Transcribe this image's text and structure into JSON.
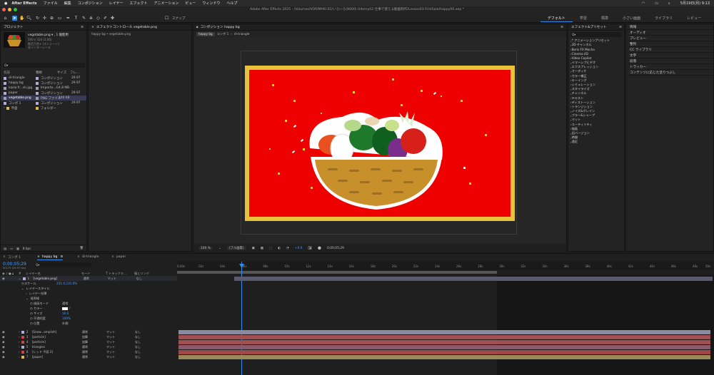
{
  "menubar": {
    "app": "After Effects",
    "items": [
      "ファイル",
      "編集",
      "コンポジション",
      "レイヤー",
      "エフェクト",
      "アニメーション",
      "ビュー",
      "ウィンドウ",
      "ヘルプ"
    ],
    "clock": "5月19日(月) 9:13"
  },
  "toolbar": {
    "window_title": "Adobe After Effects 2025 - /Volumes/VORIMAKI 02/いろいろ(8000) Udemy02 仕事で使える動画制作/Lesson03 FirstSale/happy00.aep *",
    "snap_label": "スナップ",
    "workspaces": [
      "デフォルト",
      "学習",
      "標準",
      "小さい画面",
      "ライブラリ",
      "レビュー"
    ],
    "active_workspace": "デフォルト"
  },
  "project": {
    "tab": "プロジェクト",
    "item_name": "vegetable.png ▾ , 1 個使用",
    "item_info1": "500 x 324 (1.00)",
    "item_info2": "数百万色+ (ストレート)",
    "item_info3": "非インターレース",
    "search_placeholder": "Q▾",
    "headers": [
      "名前",
      "種類",
      "サイズ",
      "フレ..."
    ],
    "rows": [
      {
        "name": "di-triangle",
        "type": "コンポジション",
        "size": "",
        "fr": "29.97",
        "color": "#b8a9d9"
      },
      {
        "name": "happy bg",
        "type": "コンポジション",
        "size": "",
        "fr": "29.97",
        "color": "#b8a9d9"
      },
      {
        "name": "kazia fr...sh.jpg",
        "type": "Importe...G",
        "size": "4.8 MB",
        "fr": "",
        "color": "#9aa2b0"
      },
      {
        "name": "paper",
        "type": "コンポジション",
        "size": "",
        "fr": "29.97",
        "color": "#b8a9d9"
      },
      {
        "name": "vegetable.png",
        "type": "PNG ファイル",
        "size": "140 KB",
        "fr": "",
        "color": "#9aa2b0"
      },
      {
        "name": "コンポ 1",
        "type": "コンポジション",
        "size": "",
        "fr": "29.97",
        "color": "#b8a9d9"
      },
      {
        "name": "平面",
        "type": "フォルダー",
        "size": "",
        "fr": "",
        "color": "#e0b94a"
      }
    ],
    "bpc": "8 bpc"
  },
  "effect_controls": {
    "tab": "エフェクトコントロール vegetable.png",
    "subtitle": "happy bg • vegetable.png"
  },
  "composition": {
    "tab": "コンポジション happy bg",
    "breadcrumbs": [
      "happy bg",
      "コンポ 1",
      "di-triangle"
    ],
    "zoom": "100 %",
    "quality": "(フル画質)",
    "exposure": "+0.0",
    "timecode": "0;00;05;29"
  },
  "effects_presets": {
    "tab": "エフェクト&プリセット",
    "search_placeholder": "Q▾",
    "items": [
      "* アニメーションプリセット",
      "3D チャンネル",
      "Boris FX Mocha",
      "Cinema 4D",
      "Video Copilot",
      "イマーシブビデオ",
      "エクスプレッション",
      "オーディオ",
      "カラー補正",
      "キーイング",
      "シミュレーション",
      "スタイライズ",
      "チャンネル",
      "テキスト",
      "ディストーション",
      "トランジション",
      "ノイズ&グレイン",
      "ブラー&シャープ",
      "マット",
      "ユーティリティ",
      "描画",
      "旧バージョン",
      "時間",
      "遠近"
    ]
  },
  "right_panel": {
    "items": [
      "情報",
      "オーディオ",
      "プレビュー",
      "整列",
      "CC ライブラリ",
      "文字",
      "段落",
      "トラッカー",
      "コンテンツに応じた塗りつぶし"
    ]
  },
  "timeline": {
    "tabs": [
      "コンポ 1",
      "happy bg",
      "di-triangle",
      "paper"
    ],
    "active_tab": "happy bg",
    "timecode": "0;00;05;29",
    "frame_info": "00179 (29.97 fps)",
    "search_placeholder": "Q▾",
    "columns": [
      "#",
      "レイヤー名",
      "モード",
      "T トラックマ...",
      "親とリンク"
    ],
    "ruler": [
      "0:00s",
      "02s",
      "04s",
      "06s",
      "08s",
      "10s",
      "12s",
      "14s",
      "16s",
      "18s",
      "20s",
      "22s",
      "24s",
      "26s",
      "28s",
      "30s",
      "32s",
      "34s",
      "36s",
      "38s",
      "40s",
      "42s",
      "44s",
      "46s",
      "48s",
      "50s"
    ],
    "layers": [
      {
        "num": "1",
        "name": "[vegetable.png]",
        "mode": "通常",
        "matte": "マット",
        "parent": "なし",
        "color": "#b8a9d9",
        "bar": "#7a7a92"
      },
      {
        "num": "2",
        "name": "[Snow...omplish]",
        "mode": "通常",
        "matte": "マット",
        "parent": "なし",
        "color": "#b8a9d9",
        "bar": "#8a8aa0"
      },
      {
        "num": "3",
        "name": "[particle]",
        "mode": "加算",
        "matte": "マット",
        "parent": "なし",
        "color": "#c44",
        "bar": "#a05050"
      },
      {
        "num": "4",
        "name": "[particle]",
        "mode": "加算",
        "matte": "マット",
        "parent": "なし",
        "color": "#c44",
        "bar": "#a05050"
      },
      {
        "num": "5",
        "name": "triangles",
        "mode": "通常",
        "matte": "マット",
        "parent": "なし",
        "color": "#b8a9d9",
        "bar": "#8a5a6a"
      },
      {
        "num": "6",
        "name": "[レッド 平面 2]",
        "mode": "通常",
        "matte": "マット",
        "parent": "なし",
        "color": "#c44",
        "bar": "#a04848"
      },
      {
        "num": "7",
        "name": "[paper]",
        "mode": "通常",
        "matte": "マット",
        "parent": "なし",
        "color": "#e0b94a",
        "bar": "#9a8a5a"
      }
    ],
    "props": [
      {
        "label": "スケール",
        "value": "231.0,231.0%"
      },
      {
        "label": "レイヤースタイル",
        "value": ""
      },
      {
        "label": "レイヤー効果",
        "value": ""
      },
      {
        "label": "境界線",
        "value": ""
      },
      {
        "label": "描画モード",
        "value": "通常"
      },
      {
        "label": "カラー",
        "value": ""
      },
      {
        "label": "サイズ",
        "value": "16.0"
      },
      {
        "label": "不透明度",
        "value": "100%"
      },
      {
        "label": "位置",
        "value": "外側"
      }
    ]
  }
}
